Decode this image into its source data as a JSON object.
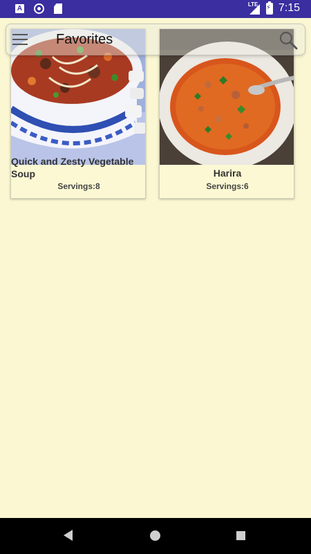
{
  "status_bar": {
    "network": "LTE",
    "time": "7:15"
  },
  "toolbar": {
    "title": "Favorites",
    "menu_icon": "hamburger-menu-icon",
    "search_icon": "search-icon"
  },
  "recipes": [
    {
      "title": "Quick and Zesty Vegetable Soup",
      "servings": "Servings:8"
    },
    {
      "title": "Harira",
      "servings": "Servings:6"
    }
  ],
  "colors": {
    "background": "#faf7d2",
    "status_bar": "#3a2ea0",
    "nav_bar": "#000000"
  }
}
